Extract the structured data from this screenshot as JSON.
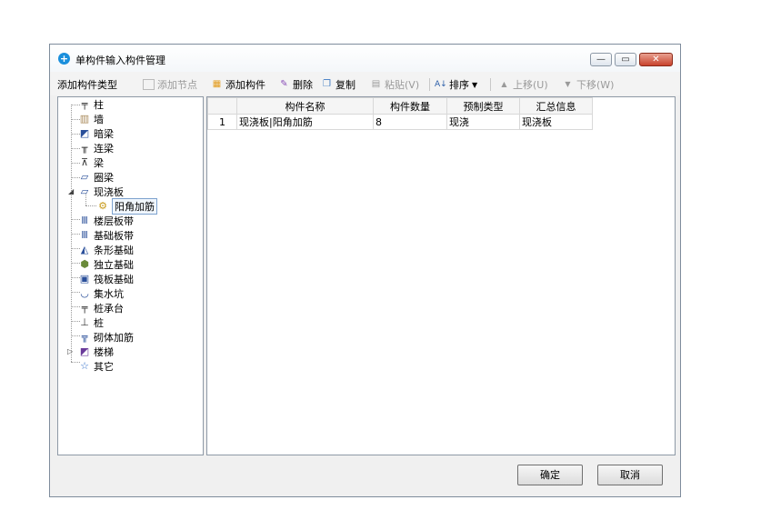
{
  "window": {
    "title": "单构件输入构件管理"
  },
  "toolbar": {
    "add_type": "添加构件类型",
    "add_node": "添加节点",
    "add_component": "添加构件",
    "delete": "删除",
    "copy": "复制",
    "paste": "粘贴(V)",
    "sort": "排序",
    "move_up": "上移(U)",
    "move_down": "下移(W)"
  },
  "tree": {
    "items": [
      {
        "label": "柱",
        "icon": "column-icon"
      },
      {
        "label": "墙",
        "icon": "wall-icon"
      },
      {
        "label": "暗梁",
        "icon": "hidden-beam-icon"
      },
      {
        "label": "连梁",
        "icon": "link-beam-icon"
      },
      {
        "label": "梁",
        "icon": "beam-icon"
      },
      {
        "label": "圈梁",
        "icon": "ring-beam-icon"
      },
      {
        "label": "现浇板",
        "icon": "cast-slab-icon",
        "expanded": true
      },
      {
        "label": "阳角加筋",
        "icon": "gear-icon",
        "selected": true,
        "child": true
      },
      {
        "label": "楼层板带",
        "icon": "floor-strip-icon"
      },
      {
        "label": "基础板带",
        "icon": "foundation-strip-icon"
      },
      {
        "label": "条形基础",
        "icon": "strip-foundation-icon"
      },
      {
        "label": "独立基础",
        "icon": "isolated-foundation-icon"
      },
      {
        "label": "筏板基础",
        "icon": "raft-foundation-icon"
      },
      {
        "label": "集水坑",
        "icon": "sump-pit-icon"
      },
      {
        "label": "桩承台",
        "icon": "pile-cap-icon"
      },
      {
        "label": "桩",
        "icon": "pile-icon"
      },
      {
        "label": "砌体加筋",
        "icon": "masonry-rebar-icon"
      },
      {
        "label": "楼梯",
        "icon": "stairs-icon",
        "collapsed": true
      },
      {
        "label": "其它",
        "icon": "star-icon"
      }
    ]
  },
  "grid": {
    "columns": [
      "构件名称",
      "构件数量",
      "预制类型",
      "汇总信息"
    ],
    "rows": [
      {
        "num": "1",
        "name": "现浇板|阳角加筋",
        "count": "8",
        "prefab": "现浇",
        "summary": "现浇板"
      }
    ]
  },
  "buttons": {
    "ok": "确定",
    "cancel": "取消"
  },
  "colors": {
    "accent": "#1a8fdc",
    "close": "#c8422c",
    "selection": "#7da2ce"
  }
}
